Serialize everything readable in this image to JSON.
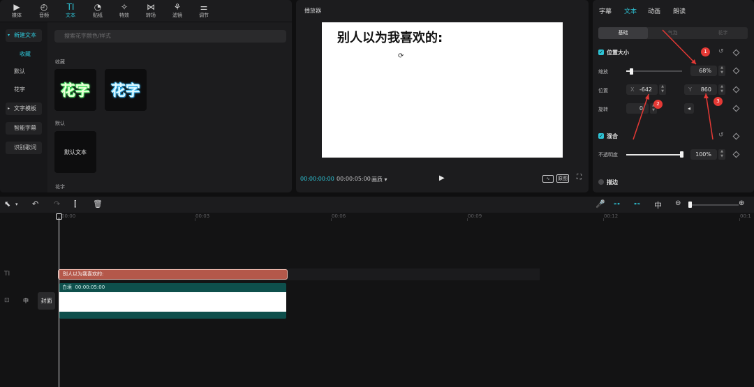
{
  "toolbar_tabs": [
    {
      "icon": "media-icon",
      "glyph": "▶",
      "label": "媒体"
    },
    {
      "icon": "audio-icon",
      "glyph": "◴",
      "label": "音频"
    },
    {
      "icon": "text-icon",
      "glyph": "TI",
      "label": "文本"
    },
    {
      "icon": "sticker-icon",
      "glyph": "◔",
      "label": "贴纸"
    },
    {
      "icon": "effects-icon",
      "glyph": "✧",
      "label": "特效"
    },
    {
      "icon": "transition-icon",
      "glyph": "⋈",
      "label": "转场"
    },
    {
      "icon": "filter-icon",
      "glyph": "⚘",
      "label": "滤镜"
    },
    {
      "icon": "adjust-icon",
      "glyph": "⚌",
      "label": "调节"
    }
  ],
  "side_nav": {
    "new_text": "新建文本",
    "favorites": "收藏",
    "default": "默认",
    "fancy_text": "花字",
    "text_template": "文字模板",
    "smart_subtitle": "智能字幕",
    "recognize_lyrics": "识别歌词"
  },
  "search": {
    "placeholder": "搜索花字颜色/样式"
  },
  "content": {
    "favorites_label": "收藏",
    "tile_fancy_1": "花字",
    "tile_fancy_2": "花字",
    "default_label": "默认",
    "default_tile_text": "默认文本",
    "fancy_label": "花字"
  },
  "player": {
    "title": "播放器",
    "canvas_text": "别人以为我喜欢的:",
    "current_time": "00:00:00:00",
    "total_time": "00:00:05:00",
    "ratio_label": "画质",
    "original_button": "原图",
    "play_glyph": "▶"
  },
  "inspector": {
    "tabs": [
      "字幕",
      "文本",
      "动画",
      "朗读"
    ],
    "segments": [
      "基础",
      "气泡",
      "花字"
    ],
    "position_size_title": "位置大小",
    "scale_label": "缩放",
    "scale_value": "68%",
    "scale_fraction": 0.1,
    "position_label": "位置",
    "x_prefix": "X",
    "x_value": "-642",
    "y_prefix": "Y",
    "y_value": "860",
    "rotate_label": "旋转",
    "rotate_value": "0",
    "blend_title": "混合",
    "opacity_label": "不透明度",
    "opacity_value": "100%",
    "opacity_fraction": 1.0,
    "anim_title": "描边",
    "markers": [
      "1",
      "2",
      "3"
    ]
  },
  "timeline": {
    "ruler": [
      "00:00",
      "00:03",
      "00:06",
      "00:09",
      "00:12",
      "00:1"
    ],
    "text_clip_label": "别人以为我喜欢的:",
    "video_clip_name": "白境",
    "video_clip_duration": "00:00:05:00",
    "cover_label": "封面",
    "audio_glyph": "中"
  },
  "colors": {
    "accent": "#2ec4d6",
    "text_clip": "#b4584a",
    "video_clip": "#0e4f4c",
    "marker": "#e53935"
  }
}
